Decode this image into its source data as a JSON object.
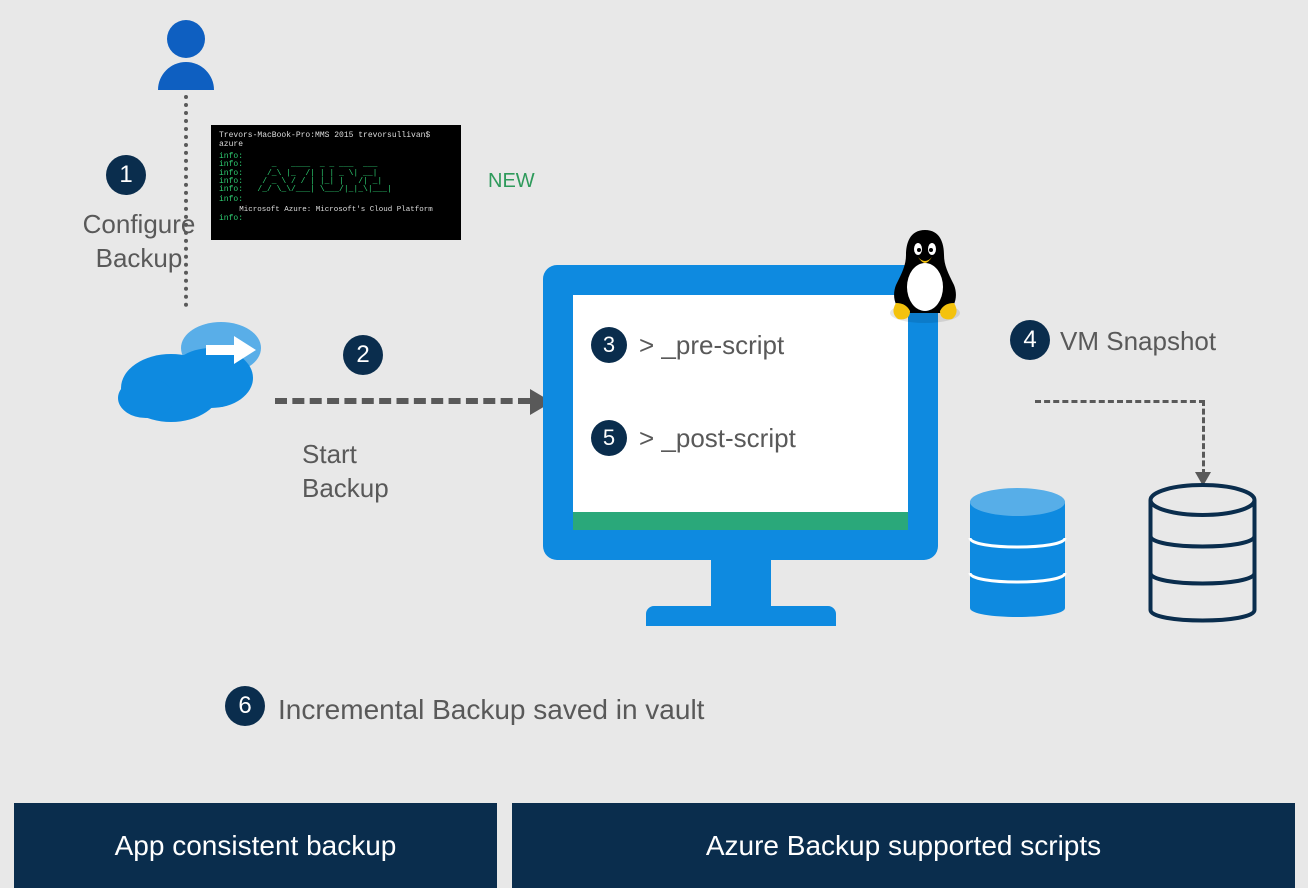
{
  "steps": {
    "s1": {
      "num": "1",
      "label": "Configure\nBackup"
    },
    "s2": {
      "num": "2",
      "label": "Start\nBackup"
    },
    "s3": {
      "num": "3",
      "label": "> _pre-script"
    },
    "s4": {
      "num": "4",
      "label": "VM Snapshot"
    },
    "s5": {
      "num": "5",
      "label": "> _post-script"
    },
    "s6": {
      "num": "6",
      "label": "Incremental Backup saved in vault"
    }
  },
  "terminal": {
    "prompt": "Trevors-MacBook-Pro:MMS 2015 trevorsullivan$ azure",
    "info_prefix": "info:",
    "footer": "Microsoft Azure: Microsoft's Cloud Platform"
  },
  "new_tag": "NEW",
  "bottom": {
    "left": "App consistent backup",
    "right": "Azure Backup supported scripts"
  },
  "colors": {
    "badge_bg": "#0a2d4d",
    "azure_blue": "#0e8ae0",
    "text_gray": "#595959",
    "new_green": "#2e9a5b"
  }
}
